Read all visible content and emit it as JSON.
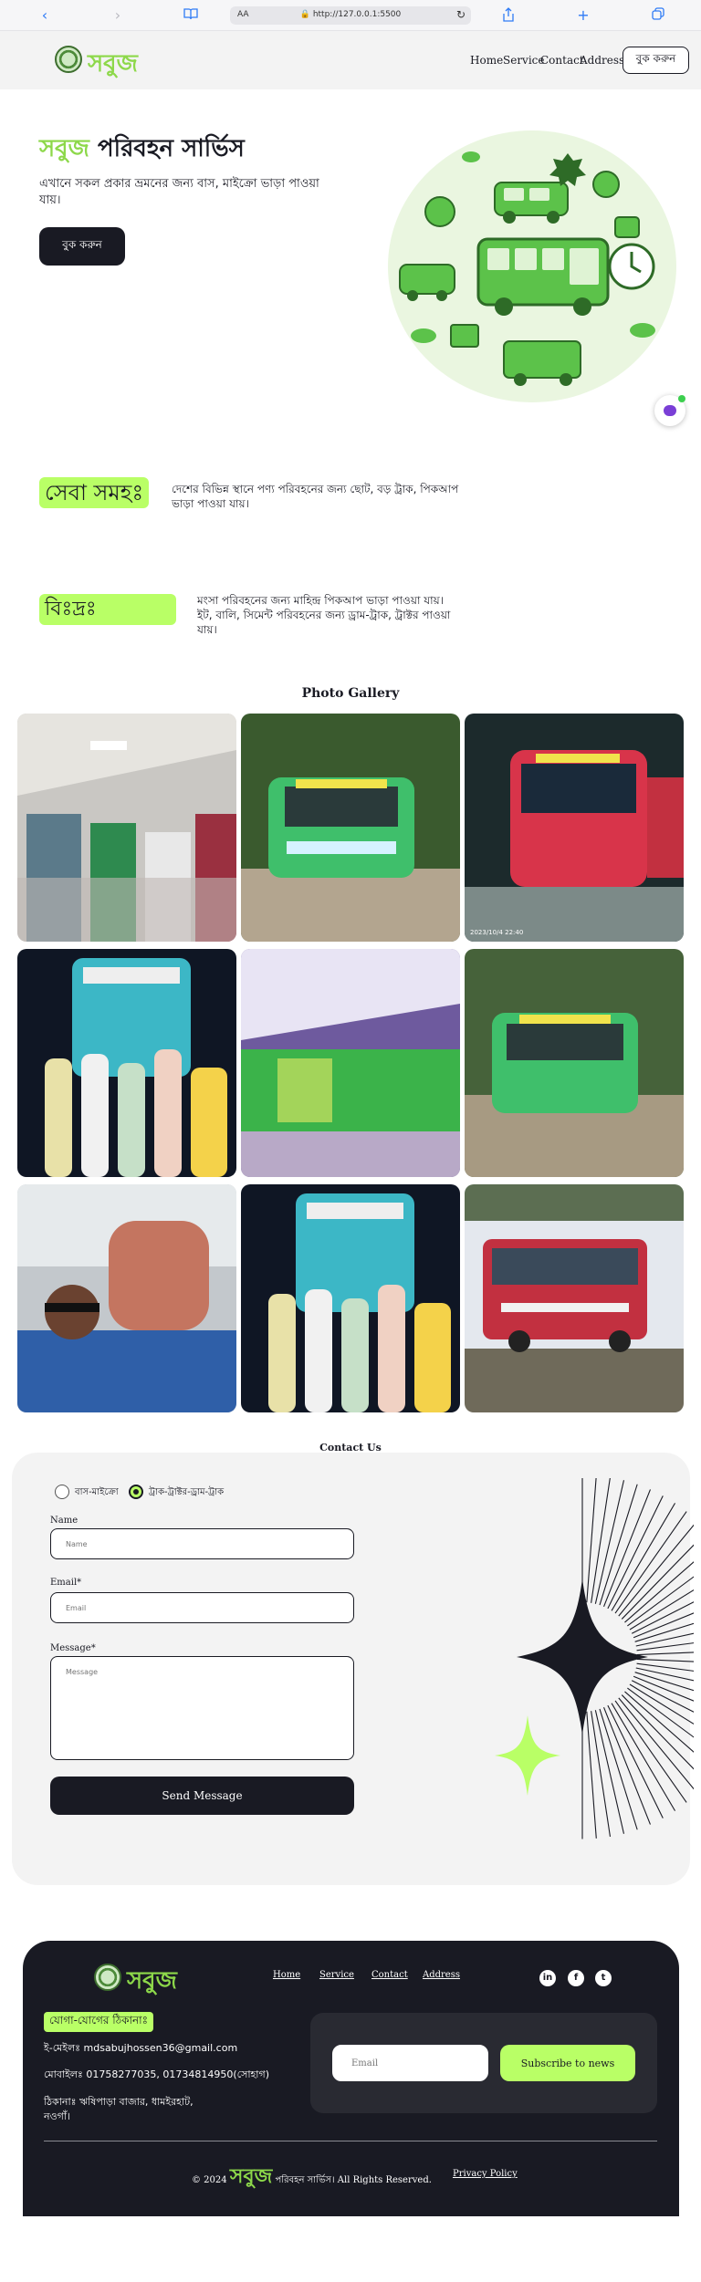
{
  "browser": {
    "url": "http://127.0.0.1:5500",
    "text_size_label": "AA"
  },
  "header": {
    "logo_text": "সবুজ",
    "nav": [
      "Home",
      "Service",
      "Contact",
      "Address"
    ],
    "cta_label": "বুক করুন"
  },
  "hero": {
    "title_highlight": "সবুজ",
    "title_rest": "পরিবহন সার্ভিস",
    "description": "এখানে সকল প্রকার ভ্রমনের জন্য বাস, মাইক্রো ভাড়া পাওয়া যায়।",
    "button_label": "বুক করুন"
  },
  "services": [
    {
      "tag": "সেবা সমহঃ",
      "description": "দেশের বিভিন্ন স্থানে পণ্য পরিবহনের জন্য ছোট, বড় ট্রাক, পিকআপ ভাড়া পাওয়া যায়।"
    },
    {
      "tag": "বিঃদ্রঃ",
      "description": "মংসা পরিবহনের জন্য মাহিন্দ্র পিকআপ ভাড়া পাওয়া যায়। ইট, বালি, সিমেন্ট পরিবহনের জন্য ড্রাম-ট্রাক, ট্রাক্টর পাওয়া যায়।"
    }
  ],
  "gallery": {
    "title": "Photo Gallery",
    "photos": [
      {
        "name": "bus-interior-seats"
      },
      {
        "name": "green-bus-front-soudia"
      },
      {
        "name": "red-bus-front-soudia",
        "caption": "2023/10/4 22:40"
      },
      {
        "name": "group-with-bus-night"
      },
      {
        "name": "bus-interior-motion"
      },
      {
        "name": "green-bus-soudia-parked"
      },
      {
        "name": "driver-selfie"
      },
      {
        "name": "group-with-bus-night-2"
      },
      {
        "name": "red-bus-parked"
      }
    ]
  },
  "contact": {
    "title": "Contact Us",
    "radio_options": [
      {
        "label": "বাস-মাইক্রো",
        "checked": false
      },
      {
        "label": "ট্রাক-ট্রাক্টর-ড্রাম-ট্রাক",
        "checked": true
      }
    ],
    "name_label": "Name",
    "name_placeholder": "Name",
    "email_label": "Email*",
    "email_placeholder": "Email",
    "message_label": "Message*",
    "message_placeholder": "Message",
    "send_label": "Send Message"
  },
  "footer": {
    "logo_text": "সবুজ",
    "nav": [
      "Home",
      "Service",
      "Contact",
      "Address"
    ],
    "social": [
      "in",
      "f",
      "t"
    ],
    "contact_tag": "যোগা-যোগের ঠিকানাঃ",
    "email": "ই-মেইলঃ mdsabujhossen36@gmail.com",
    "phone": "মোবাইলঃ 01758277035, 01734814950(সোহাগ)",
    "address": "ঠিকানাঃ ঋষিপাড়া বাজার, ধামইরহাট, নওগাঁ।",
    "newsletter_placeholder": "Email",
    "newsletter_button": "Subscribe to news",
    "copyright_prefix": "© 2024",
    "copyright_brand": "সবুজ",
    "copyright_suffix": "পরিবহন সার্ভিস। All Rights Reserved.",
    "privacy": "Privacy Policy"
  },
  "colors": {
    "accent": "#b9ff66",
    "brand_green": "#8dd84a",
    "dark": "#191a23",
    "card": "#f3f3f3"
  }
}
